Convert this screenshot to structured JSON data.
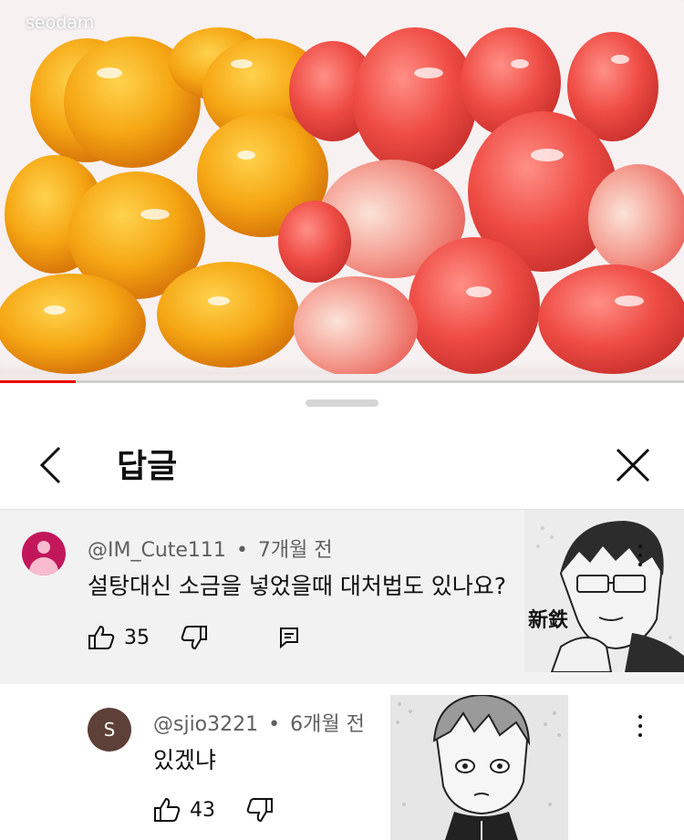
{
  "video": {
    "watermark": "seodam",
    "progress": 0.11
  },
  "sheet": {
    "title": "답글"
  },
  "comments": [
    {
      "author": "@IM_Cute111",
      "separator": "•",
      "time": "7개월 전",
      "text": "설탕대신 소금을 넣었을때 대처법도 있나요?",
      "likes": "35"
    },
    {
      "author": "@sjio3221",
      "separator": "•",
      "time": "6개월 전",
      "text": "있겠냐",
      "likes": "43",
      "avatar_letter": "S"
    }
  ],
  "icons": {
    "back": "chevron-left-icon",
    "close": "close-icon",
    "like": "thumbs-up-icon",
    "dislike": "thumbs-down-icon",
    "reply": "comment-icon",
    "more": "more-vertical-icon"
  }
}
